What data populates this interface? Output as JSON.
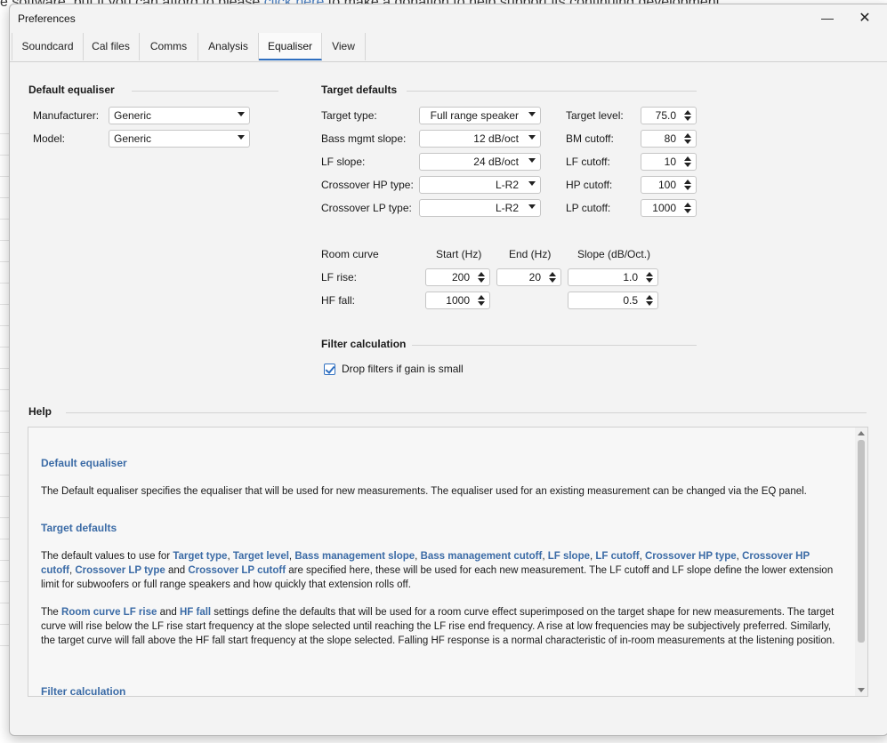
{
  "background": {
    "banner_prefix": "e software, but if you can afford to please ",
    "banner_link": "click here",
    "banner_suffix": " to make a donation to help support its continuing development"
  },
  "window": {
    "title": "Preferences",
    "minimize_glyph": "—",
    "close_glyph": "✕"
  },
  "tabs": [
    {
      "label": "Soundcard"
    },
    {
      "label": "Cal files"
    },
    {
      "label": "Comms"
    },
    {
      "label": "Analysis"
    },
    {
      "label": "Equaliser",
      "active": true
    },
    {
      "label": "View"
    }
  ],
  "default_equaliser": {
    "title": "Default equaliser",
    "manufacturer_label": "Manufacturer:",
    "manufacturer_value": "Generic",
    "model_label": "Model:",
    "model_value": "Generic"
  },
  "target_defaults": {
    "title": "Target defaults",
    "target_type_label": "Target type:",
    "target_type_value": "Full range speaker",
    "bass_mgmt_slope_label": "Bass mgmt slope:",
    "bass_mgmt_slope_value": "12 dB/oct",
    "lf_slope_label": "LF slope:",
    "lf_slope_value": "24 dB/oct",
    "crossover_hp_type_label": "Crossover HP type:",
    "crossover_hp_type_value": "L-R2",
    "crossover_lp_type_label": "Crossover LP type:",
    "crossover_lp_type_value": "L-R2",
    "target_level_label": "Target level:",
    "target_level_value": "75.0",
    "bm_cutoff_label": "BM cutoff:",
    "bm_cutoff_value": "80",
    "lf_cutoff_label": "LF cutoff:",
    "lf_cutoff_value": "10",
    "hp_cutoff_label": "HP cutoff:",
    "hp_cutoff_value": "100",
    "lp_cutoff_label": "LP cutoff:",
    "lp_cutoff_value": "1000"
  },
  "room_curve": {
    "label": "Room curve",
    "start_header": "Start (Hz)",
    "end_header": "End (Hz)",
    "slope_header": "Slope (dB/Oct.)",
    "lf_rise_label": "LF rise:",
    "lf_rise_start": "200",
    "lf_rise_end": "20",
    "lf_rise_slope": "1.0",
    "hf_fall_label": "HF fall:",
    "hf_fall_start": "1000",
    "hf_fall_slope": "0.5"
  },
  "filter_calculation": {
    "title": "Filter calculation",
    "drop_filters_label": "Drop filters if gain is small",
    "drop_filters_checked": true
  },
  "help": {
    "title": "Help",
    "h1": "Default equaliser",
    "p1": "The Default equaliser specifies the equaliser that will be used for new measurements. The equaliser used for an existing measurement can be changed via the EQ panel.",
    "h2": "Target defaults",
    "p2_pre": "The default values to use for ",
    "kw_target_type": "Target type",
    "sep1": ", ",
    "kw_target_level": "Target level",
    "sep2": ", ",
    "kw_bass_mgmt_slope": "Bass management slope",
    "sep3": ", ",
    "kw_bass_mgmt_cutoff": "Bass management cutoff",
    "sep4": ", ",
    "kw_lf_slope": "LF slope",
    "sep5": ", ",
    "kw_lf_cutoff": "LF cutoff",
    "sep6": ", ",
    "kw_crossover_hp_type": "Crossover HP type",
    "sep7": ", ",
    "kw_crossover_hp_cutoff": "Crossover HP cutoff",
    "sep8": ", ",
    "kw_crossover_lp_type": "Crossover LP type",
    "sep9": " and ",
    "kw_crossover_lp_cutoff": "Crossover LP cutoff",
    "p2_post": " are specified here, these will be used for each new measurement. The LF cutoff and LF slope define the lower extension limit for subwoofers or full range speakers and how quickly that extension rolls off.",
    "p3_pre": "The ",
    "kw_room_curve_lf_rise": "Room curve LF rise",
    "p3_and": " and ",
    "kw_hf_fall": "HF fall",
    "p3_post": " settings define the defaults that will be used for a room curve effect superimposed on the target shape for new measurements. The target curve will rise below the LF rise start frequency at the slope selected until reaching the LF rise end frequency. A rise at low frequencies may be subjectively preferred. Similarly, the target curve will fall above the HF fall start frequency at the slope selected. Falling HF response is a normal characteristic of in-room measurements at the listening position.",
    "h4": "Filter calculation"
  }
}
